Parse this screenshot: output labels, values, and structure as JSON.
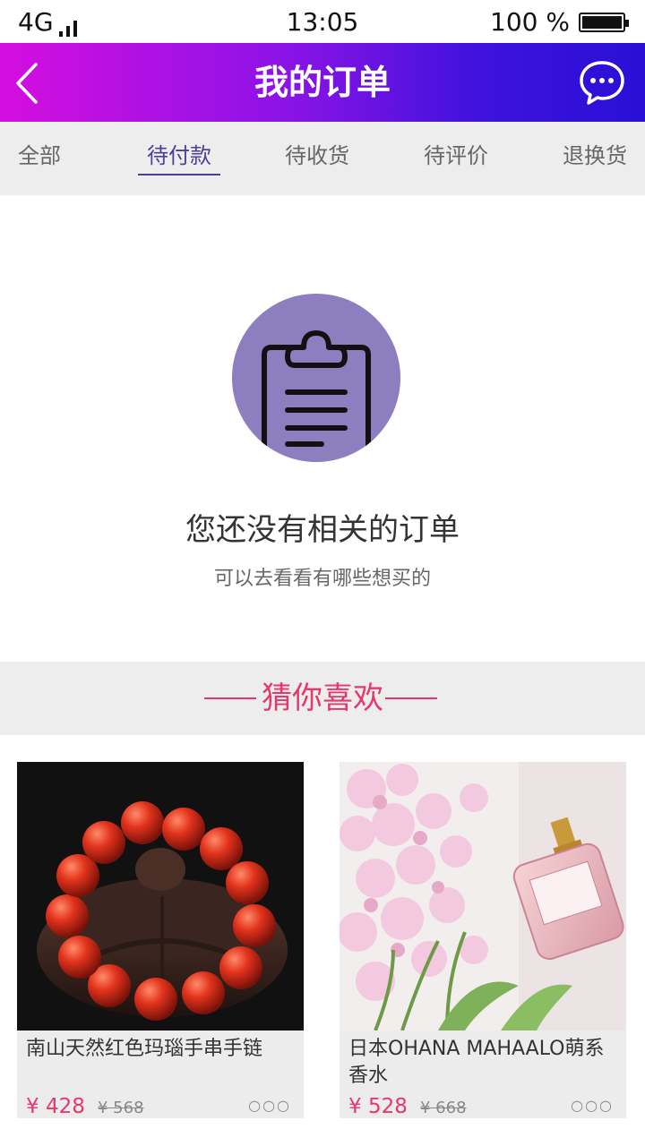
{
  "status": {
    "network": "4G",
    "time": "13:05",
    "battery": "100 %"
  },
  "header": {
    "title": "我的订单"
  },
  "tabs": [
    {
      "label": "全部"
    },
    {
      "label": "待付款",
      "active": true
    },
    {
      "label": "待收货"
    },
    {
      "label": "待评价"
    },
    {
      "label": "退换货"
    }
  ],
  "empty": {
    "title": "您还没有相关的订单",
    "subtitle": "可以去看看有哪些想买的"
  },
  "recommend": {
    "title": "猜你喜欢"
  },
  "products": [
    {
      "name": "南山天然红色玛瑙手串手链",
      "price": "¥ 428",
      "old_price": "¥ 568",
      "more": "○○○"
    },
    {
      "name": "日本OHANA MAHAALO萌系香水",
      "price": "¥ 528",
      "old_price": "¥ 668",
      "more": "○○○",
      "label_text": "OHANA MAHAALO"
    }
  ],
  "colors": {
    "accent": "#e8376a",
    "tab_active": "#4b3f9a",
    "icon_bg": "#8d7ebf"
  }
}
